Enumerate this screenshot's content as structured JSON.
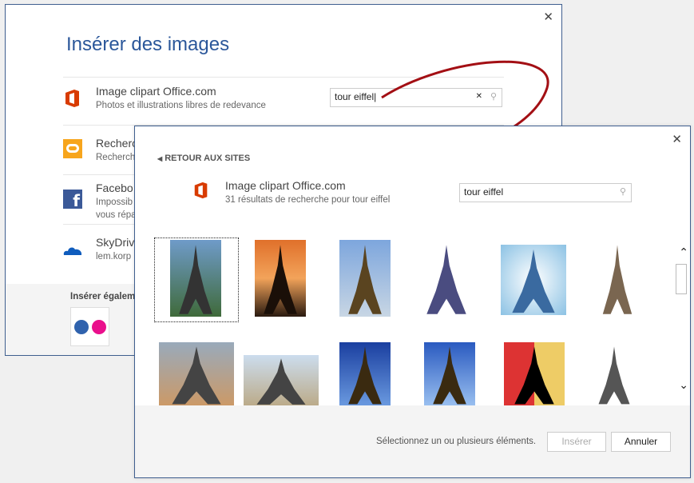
{
  "back_dialog": {
    "title": "Insérer des images",
    "close": "✕",
    "sources": [
      {
        "name": "Image clipart Office.com",
        "desc": "Photos et illustrations libres de redevance",
        "icon": "office-icon"
      },
      {
        "name": "Recherche",
        "desc": "Recherch",
        "icon": "bing-icon"
      },
      {
        "name": "Facebo",
        "desc": "Impossib",
        "desc2": "vous répa",
        "icon": "facebook-icon"
      },
      {
        "name": "SkyDriv",
        "desc": "lem.korp",
        "icon": "skydrive-icon"
      }
    ],
    "search_value": "tour eiffel",
    "clear": "✕",
    "also_insert": "Insérer égalem"
  },
  "front_dialog": {
    "close": "✕",
    "back_link": "RETOUR AUX SITES",
    "source_name": "Image clipart Office.com",
    "results_text": "31 résultats de recherche pour tour eiffel",
    "search_value": "tour eiffel",
    "status": "Sélectionnez un ou plusieurs éléments.",
    "insert_label": "Insérer",
    "cancel_label": "Annuler",
    "scroll_up": "⌃",
    "scroll_down": "⌄"
  },
  "colors": {
    "accent": "#2b579a",
    "office": "#d83b01",
    "arrow": "#a30f14"
  }
}
